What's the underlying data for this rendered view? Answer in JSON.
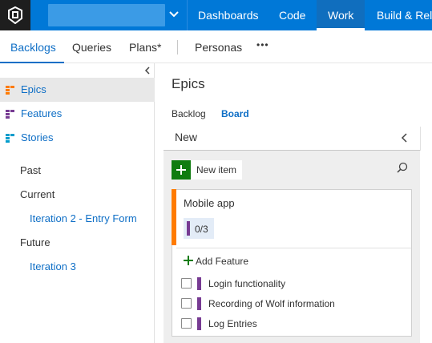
{
  "colors": {
    "topbar": "#0078d7",
    "logo_bg": "#1e1e1e",
    "link": "#0f6fc6",
    "epic_orange": "#ff7b00",
    "feature_purple": "#773b93",
    "add_green": "#107c10"
  },
  "topbar": {
    "logo_icon": "vsts-logo-icon",
    "project_caret_icon": "chevron-down-icon",
    "nav": [
      "Dashboards",
      "Code",
      "Work",
      "Build & Rele"
    ],
    "active_nav": "Work"
  },
  "subnav": {
    "items": [
      "Backlogs",
      "Queries",
      "Plans*",
      "Personas"
    ],
    "active": "Backlogs",
    "more_label": "•••"
  },
  "sidebar": {
    "collapse_icon": "chevron-left-icon",
    "backlog_levels": [
      {
        "label": "Epics",
        "icon": "epic-backlog-icon",
        "selected": true
      },
      {
        "label": "Features",
        "icon": "feature-backlog-icon",
        "selected": false
      },
      {
        "label": "Stories",
        "icon": "story-backlog-icon",
        "selected": false
      }
    ],
    "past_label": "Past",
    "current_label": "Current",
    "current_iteration": "Iteration 2 - Entry Form",
    "future_label": "Future",
    "future_iteration": "Iteration 3"
  },
  "main": {
    "title": "Epics",
    "tabs": [
      "Backlog",
      "Board"
    ],
    "active_tab": "Board",
    "column": {
      "header": "New",
      "new_item_label": "New item",
      "search_icon": "search-icon",
      "card": {
        "title": "Mobile app",
        "progress": "0/3",
        "add_child_label": "Add Feature",
        "children": [
          {
            "title": "Login functionality",
            "checked": false
          },
          {
            "title": "Recording of Wolf information",
            "checked": false
          },
          {
            "title": "Log Entries",
            "checked": false
          }
        ]
      }
    }
  }
}
